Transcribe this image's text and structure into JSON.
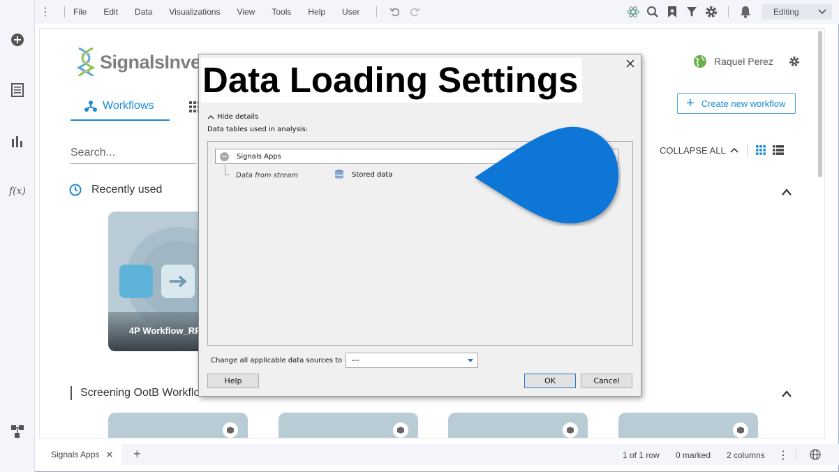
{
  "menubar": {
    "items": [
      "File",
      "Edit",
      "Data",
      "Visualizations",
      "View",
      "Tools",
      "Help",
      "User"
    ],
    "mode": "Editing"
  },
  "header": {
    "logo_text": "SignalsInve",
    "user_name": "Raquel Perez"
  },
  "tabs": {
    "workflows": "Workflows"
  },
  "create_button": "Create new workflow",
  "search": {
    "placeholder": "Search..."
  },
  "toolbar": {
    "collapse_all": "COLLAPSE ALL"
  },
  "recent": {
    "heading": "Recently used",
    "card_title": "4P Workflow_RP"
  },
  "section2": {
    "heading": "Screening OotB Workflow"
  },
  "statusbar": {
    "tab_label": "Signals Apps",
    "rows": "1 of 1 row",
    "marked": "0 marked",
    "columns": "2 columns"
  },
  "dialog": {
    "title": "Data Loading Settings",
    "hide_details": "Hide details",
    "tables_label": "Data tables used in analysis:",
    "table_name": "Signals Apps",
    "source_label": "Data from stream",
    "stored_label": "Stored data",
    "change_label": "Change all applicable data sources to",
    "change_value": "---",
    "help": "Help",
    "ok": "OK",
    "cancel": "Cancel"
  },
  "colors": {
    "accent": "#1a8ad4",
    "drop_marker": "#0b76d6"
  }
}
